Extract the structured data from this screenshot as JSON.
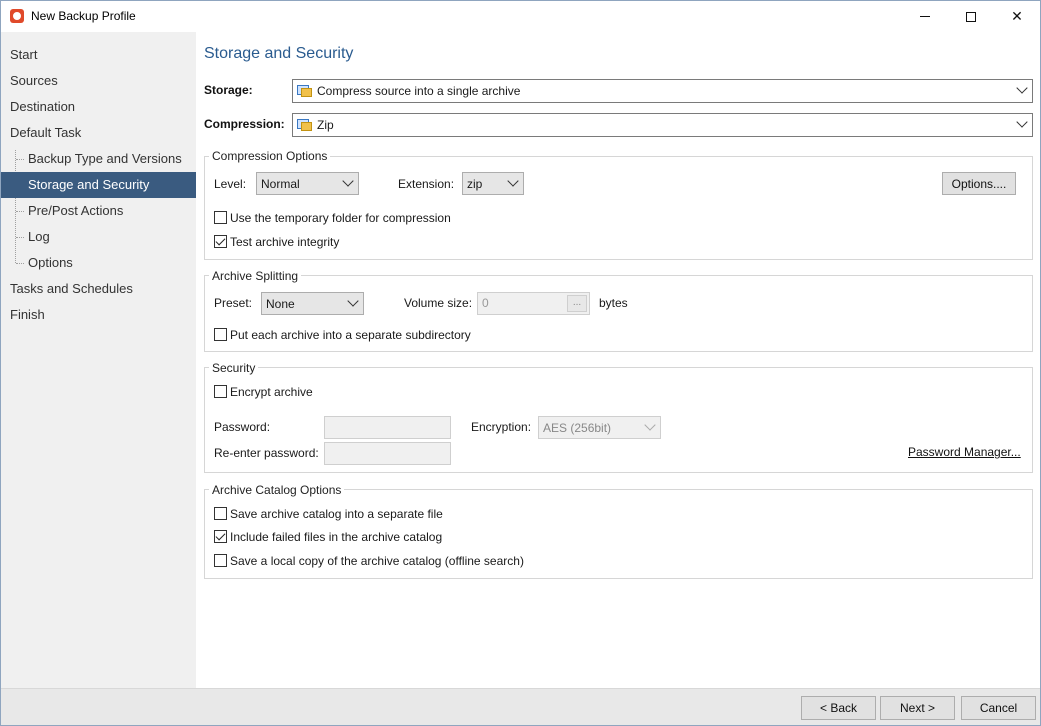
{
  "window": {
    "title": "New Backup Profile"
  },
  "sidebar": {
    "items": [
      {
        "label": "Start"
      },
      {
        "label": "Sources"
      },
      {
        "label": "Destination"
      },
      {
        "label": "Default Task"
      },
      {
        "label": "Backup Type and Versions"
      },
      {
        "label": "Storage and Security",
        "active": true
      },
      {
        "label": "Pre/Post Actions"
      },
      {
        "label": "Log"
      },
      {
        "label": "Options"
      },
      {
        "label": "Tasks and Schedules"
      },
      {
        "label": "Finish"
      }
    ]
  },
  "page": {
    "heading": "Storage and Security",
    "storage": {
      "label": "Storage:",
      "value": "Compress source into a single archive"
    },
    "compression": {
      "label": "Compression:",
      "value": "Zip"
    },
    "compression_options": {
      "title": "Compression Options",
      "level_label": "Level:",
      "level_value": "Normal",
      "extension_label": "Extension:",
      "extension_value": "zip",
      "options_button": "Options....",
      "temp_folder": {
        "label": "Use the temporary folder for compression",
        "checked": false
      },
      "test_integrity": {
        "label": "Test archive integrity",
        "checked": true
      }
    },
    "archive_splitting": {
      "title": "Archive Splitting",
      "preset_label": "Preset:",
      "preset_value": "None",
      "volume_label": "Volume size:",
      "volume_value": "0",
      "volume_button": "...",
      "volume_unit": "bytes",
      "subdirectory": {
        "label": "Put each archive into a separate subdirectory",
        "checked": false
      }
    },
    "security": {
      "title": "Security",
      "encrypt": {
        "label": "Encrypt archive",
        "checked": false
      },
      "password_label": "Password:",
      "reenter_label": "Re-enter password:",
      "encryption_label": "Encryption:",
      "encryption_value": "AES (256bit)",
      "password_manager": "Password Manager..."
    },
    "catalog": {
      "title": "Archive Catalog Options",
      "separate_file": {
        "label": "Save archive catalog into a separate file",
        "checked": false
      },
      "include_failed": {
        "label": "Include failed files in the archive catalog",
        "checked": true
      },
      "local_copy": {
        "label": "Save a local copy of the archive catalog (offline search)",
        "checked": false
      }
    }
  },
  "footer": {
    "back": "< Back",
    "next": "Next >",
    "cancel": "Cancel"
  }
}
